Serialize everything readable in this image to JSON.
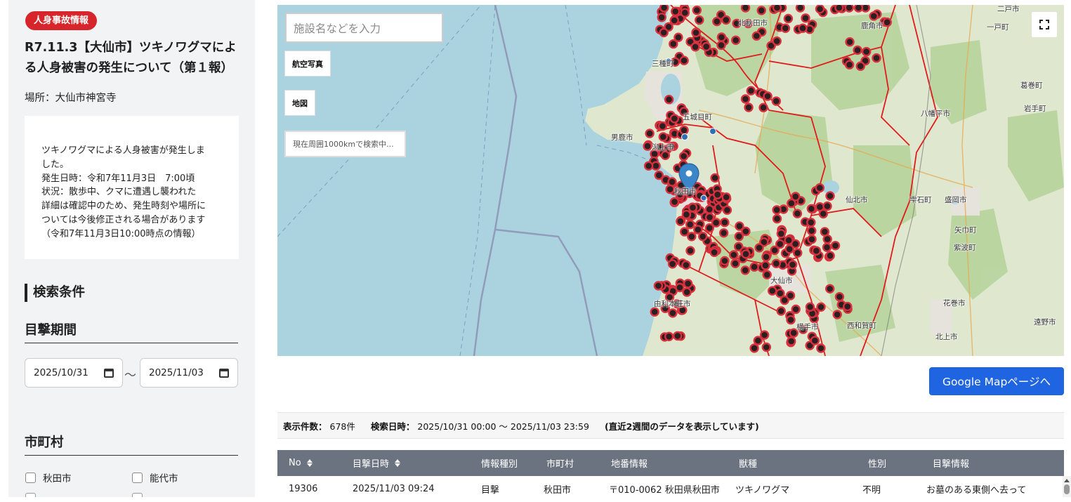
{
  "incident": {
    "badge": "人身事故情報",
    "title": "R7.11.3【大仙市】ツキノワグマによる人身被害の発生について（第１報）",
    "place": "場所：大仙市神宮寺",
    "details": [
      "ツキノワグマによる人身被害が発生しま",
      "した。",
      "発生日時：令和7年11月3日　7:00頃",
      "状況：散歩中、クマに遭遇し襲われた",
      "詳細は確認中のため、発生時刻や場所に",
      "ついては今後修正される場合があります",
      "（令和7年11月3日10:00時点の情報）"
    ]
  },
  "search": {
    "heading": "検索条件",
    "period_heading": "目撃期間",
    "date_from": "2025/10/31",
    "date_to": "2025/11/03",
    "date_sep": "～",
    "municipality_heading": "市町村",
    "municipalities": [
      "秋田市",
      "能代市"
    ]
  },
  "map": {
    "search_placeholder": "施設名などを入力",
    "btn_aerial": "航空写真",
    "btn_map": "地図",
    "status": "現在周囲1000kmで検索中...",
    "labels": [
      "北秋田市",
      "鹿角市",
      "二戸市",
      "一戸町",
      "三種町",
      "葛巻町",
      "岩手町",
      "八幡平市",
      "五城目町",
      "男鹿市",
      "潟上市",
      "秋田市",
      "仙北市",
      "雫石町",
      "盛岡市",
      "矢巾町",
      "紫波町",
      "大仙市",
      "由利本荘市",
      "花巻市",
      "西和賀町",
      "遠野市",
      "横手市",
      "北上市"
    ],
    "colors": {
      "sea": "#aad3df",
      "land": "#dfe8cf",
      "forest": "#b5d29a",
      "border": "#e01b1b",
      "marker": "#c8303a",
      "pin": "#3a86c8"
    }
  },
  "google_map_button": "Google Mapページへ",
  "summary": {
    "count_label": "表示件数：",
    "count_value": "678件",
    "time_label": "検索日時：",
    "time_value": "2025/10/31 00:00 ～ 2025/11/03 23:59",
    "note": "(直近2週間のデータを表示しています)"
  },
  "table": {
    "headers": [
      "No",
      "目撃日時",
      "情報種別",
      "市町村",
      "地番情報",
      "獣種",
      "性別",
      "目撃情報"
    ],
    "rows": [
      [
        "19306",
        "2025/11/03 09:24",
        "目撃",
        "秋田市",
        "〒010-0062 秋田県秋田市",
        "ツキノワグマ",
        "不明",
        "お墓のある東側へ去って"
      ]
    ]
  }
}
